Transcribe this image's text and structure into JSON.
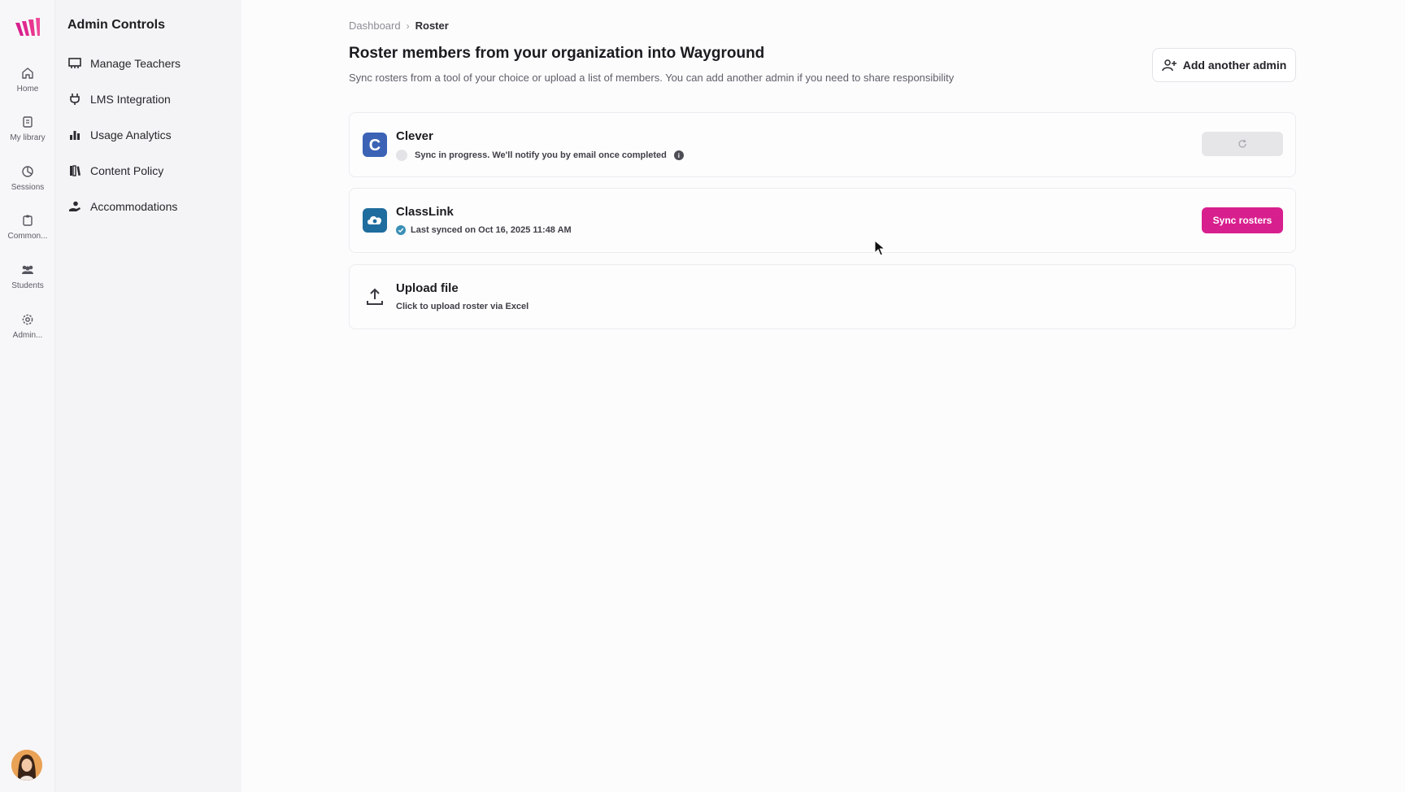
{
  "rail": {
    "items": [
      {
        "label": "Home",
        "icon": "home-icon"
      },
      {
        "label": "My library",
        "icon": "library-icon"
      },
      {
        "label": "Sessions",
        "icon": "sessions-icon"
      },
      {
        "label": "Common...",
        "icon": "clipboard-icon"
      },
      {
        "label": "Students",
        "icon": "students-icon"
      },
      {
        "label": "Admin...",
        "icon": "gear-icon"
      }
    ]
  },
  "sidebar": {
    "title": "Admin Controls",
    "items": [
      {
        "label": "Manage Teachers",
        "icon": "teachers-icon"
      },
      {
        "label": "LMS Integration",
        "icon": "plug-icon"
      },
      {
        "label": "Usage Analytics",
        "icon": "bar-chart-icon"
      },
      {
        "label": "Content Policy",
        "icon": "book-icon"
      },
      {
        "label": "Accommodations",
        "icon": "hand-user-icon"
      }
    ]
  },
  "breadcrumb": {
    "root": "Dashboard",
    "separator": "›",
    "current": "Roster"
  },
  "header": {
    "title": "Roster members from your organization into Wayground",
    "subtitle": "Sync rosters from a tool of your choice or upload a list of members. You can add another admin if you need to share responsibility",
    "add_admin_label": "Add another admin"
  },
  "cards": {
    "clever": {
      "name": "Clever",
      "logo_letter": "C",
      "status": "Sync in progress. We'll notify you by email once completed"
    },
    "classlink": {
      "name": "ClassLink",
      "status": "Last synced on Oct 16, 2025 11:48 AM",
      "button": "Sync rosters"
    },
    "upload": {
      "name": "Upload file",
      "status": "Click to upload roster via Excel"
    }
  },
  "colors": {
    "accent": "#d81f8e",
    "clever": "#3b62b5",
    "classlink": "#1f6d9e",
    "check": "#3a8fb5"
  }
}
